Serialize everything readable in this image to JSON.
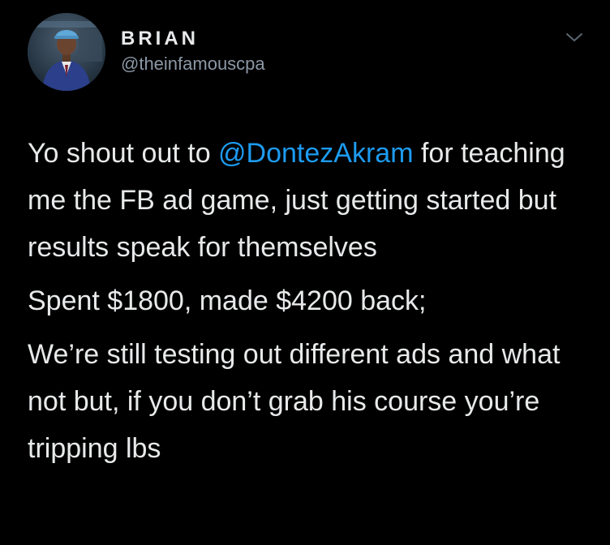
{
  "author": {
    "display_name": "BRIAN",
    "handle": "@theinfamouscpa",
    "avatar_icon": "profile-photo"
  },
  "menu": {
    "icon": "chevron-down-icon"
  },
  "tweet": {
    "p1_before": "Yo shout out to ",
    "mention": "@DontezAkram",
    "p1_after": " for teaching me the FB ad game, just getting started but results speak for themselves",
    "p2": "Spent $1800, made $4200 back;",
    "p3": "We’re still testing out different ads and what not but, if you don’t grab his course you’re tripping lbs"
  },
  "colors": {
    "background": "#000000",
    "text": "#e7e9ea",
    "secondary": "#8b98a5",
    "link": "#1d9bf0"
  }
}
